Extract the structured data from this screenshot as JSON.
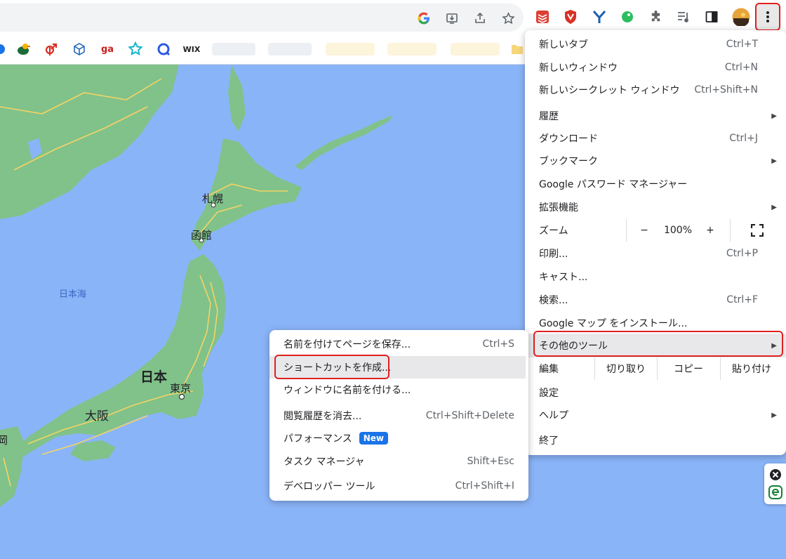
{
  "toolbar": {
    "omnibox_icons": [
      "google-g-icon",
      "install-app-icon",
      "share-icon",
      "star-icon"
    ],
    "extensions": [
      "todoist-icon",
      "shield-extension-icon",
      "y-extension-icon",
      "evernote-icon",
      "puzzle-extensions-icon",
      "reading-list-icon",
      "side-panel-icon",
      "profile-avatar"
    ]
  },
  "bookmarks": {
    "items": [
      "wix-like-icon",
      "ga",
      "WIX"
    ],
    "ga_label": "ga",
    "wix_label": "WIX"
  },
  "map": {
    "labels": {
      "sea_of_japan": "日本海",
      "sapporo": "札幌",
      "hakodate": "函館",
      "japan": "日本",
      "tokyo": "東京",
      "osaka": "大阪",
      "partial_left": "岡"
    }
  },
  "menu": {
    "items": [
      {
        "label": "新しいタブ",
        "shortcut": "Ctrl+T"
      },
      {
        "label": "新しいウィンドウ",
        "shortcut": "Ctrl+N"
      },
      {
        "label": "新しいシークレット ウィンドウ",
        "shortcut": "Ctrl+Shift+N"
      },
      {
        "label": "履歴",
        "shortcut": ""
      },
      {
        "label": "ダウンロード",
        "shortcut": "Ctrl+J"
      },
      {
        "label": "ブックマーク",
        "shortcut": ""
      },
      {
        "label": "Google パスワード マネージャー",
        "shortcut": ""
      },
      {
        "label": "拡張機能",
        "shortcut": ""
      },
      {
        "label": "ズーム",
        "shortcut": ""
      },
      {
        "label": "印刷...",
        "shortcut": "Ctrl+P"
      },
      {
        "label": "キャスト...",
        "shortcut": ""
      },
      {
        "label": "検索...",
        "shortcut": "Ctrl+F"
      },
      {
        "label": "Google マップ をインストール...",
        "shortcut": ""
      },
      {
        "label": "その他のツール",
        "shortcut": ""
      },
      {
        "label": "編集",
        "shortcut": ""
      },
      {
        "label": "設定",
        "shortcut": ""
      },
      {
        "label": "ヘルプ",
        "shortcut": ""
      },
      {
        "label": "終了",
        "shortcut": ""
      }
    ],
    "zoom": {
      "minus": "−",
      "value": "100%",
      "plus": "+"
    },
    "edit": {
      "cut": "切り取り",
      "copy": "コピー",
      "paste": "貼り付け"
    }
  },
  "submenu": {
    "items": [
      {
        "label": "名前を付けてページを保存...",
        "shortcut": "Ctrl+S"
      },
      {
        "label": "ショートカットを作成...",
        "shortcut": ""
      },
      {
        "label": "ウィンドウに名前を付ける...",
        "shortcut": ""
      },
      {
        "label": "閲覧履歴を消去...",
        "shortcut": "Ctrl+Shift+Delete"
      },
      {
        "label": "パフォーマンス",
        "shortcut": ""
      },
      {
        "label": "タスク マネージャ",
        "shortcut": "Shift+Esc"
      },
      {
        "label": "デベロッパー ツール",
        "shortcut": "Ctrl+Shift+I"
      }
    ],
    "new_badge": "New"
  },
  "colors": {
    "highlight_border": "#e02020",
    "sea": "#8ab4f8",
    "land": "#7fbf87",
    "badge": "#1a73e8"
  }
}
